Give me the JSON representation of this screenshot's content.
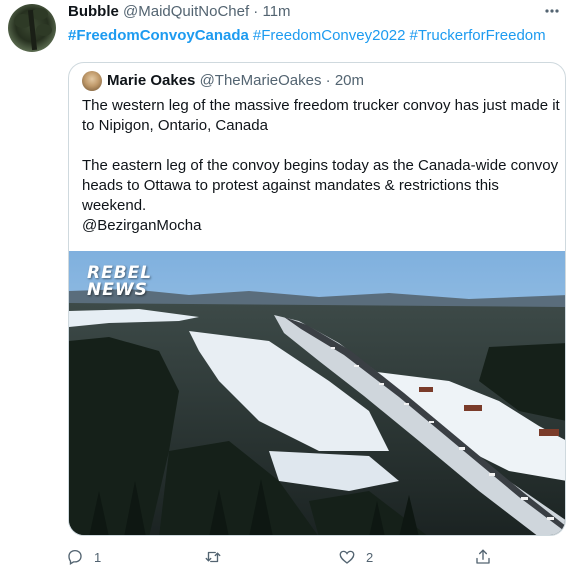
{
  "tweet": {
    "author_name": "Bubble",
    "author_handle": "@MaidQuitNoChef",
    "separator": "·",
    "time": "11m",
    "hashtags": [
      "#FreedomConvoyCanada",
      "#FreedomConvey2022",
      "#TruckerforFreedom"
    ]
  },
  "quoted": {
    "author_name": "Marie Oakes",
    "author_handle": "@TheMarieOakes",
    "separator": "·",
    "time": "20m",
    "paragraph1": "The western leg of the massive freedom trucker convoy has just made it to Nipigon, Ontario, Canada",
    "paragraph2": "The eastern leg of the convoy begins today as the Canada-wide convoy heads to Ottawa to protest against mandates & restrictions this weekend.",
    "mention": "@BezirganMocha",
    "media_logo_line1": "REBEL",
    "media_logo_line2": "NEWS"
  },
  "actions": {
    "reply_count": "1",
    "retweet_count": "",
    "like_count": "2"
  },
  "icons": [
    "more-icon",
    "reply-icon",
    "retweet-icon",
    "like-icon",
    "share-icon"
  ],
  "colors": {
    "link": "#1d9bf0",
    "muted": "#536471",
    "border": "#cfd9de"
  }
}
